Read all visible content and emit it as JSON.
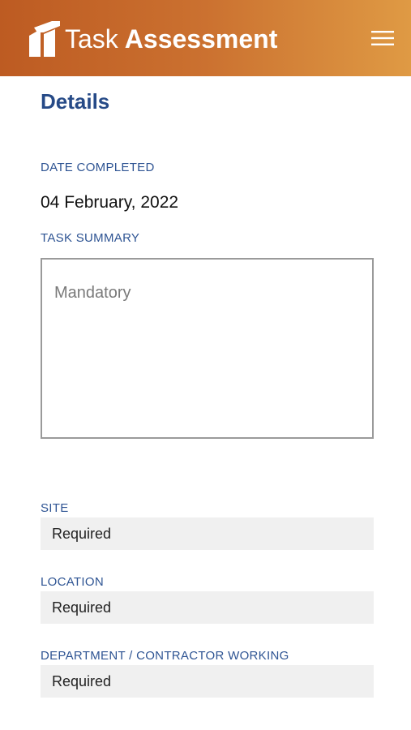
{
  "header": {
    "app_title_light": "Task",
    "app_title_bold": "Assessment",
    "logo_icon": "building-logo-icon",
    "menu_icon": "hamburger-menu-icon",
    "background_start": "#bd5b22",
    "background_end": "#df9a44"
  },
  "details": {
    "title": "Details",
    "date_completed": {
      "label": "DATE COMPLETED",
      "value": "04 February, 2022"
    },
    "task_summary": {
      "label": "TASK SUMMARY",
      "placeholder": "Mandatory",
      "value": ""
    },
    "site": {
      "label": "SITE",
      "value": "Required"
    },
    "location": {
      "label": "LOCATION",
      "value": "Required"
    },
    "department": {
      "label": "DEPARTMENT / CONTRACTOR WORKING",
      "value": "Required"
    }
  },
  "colors": {
    "heading": "#264a87",
    "label": "#2e5493",
    "field_background": "#f0f0f0"
  }
}
